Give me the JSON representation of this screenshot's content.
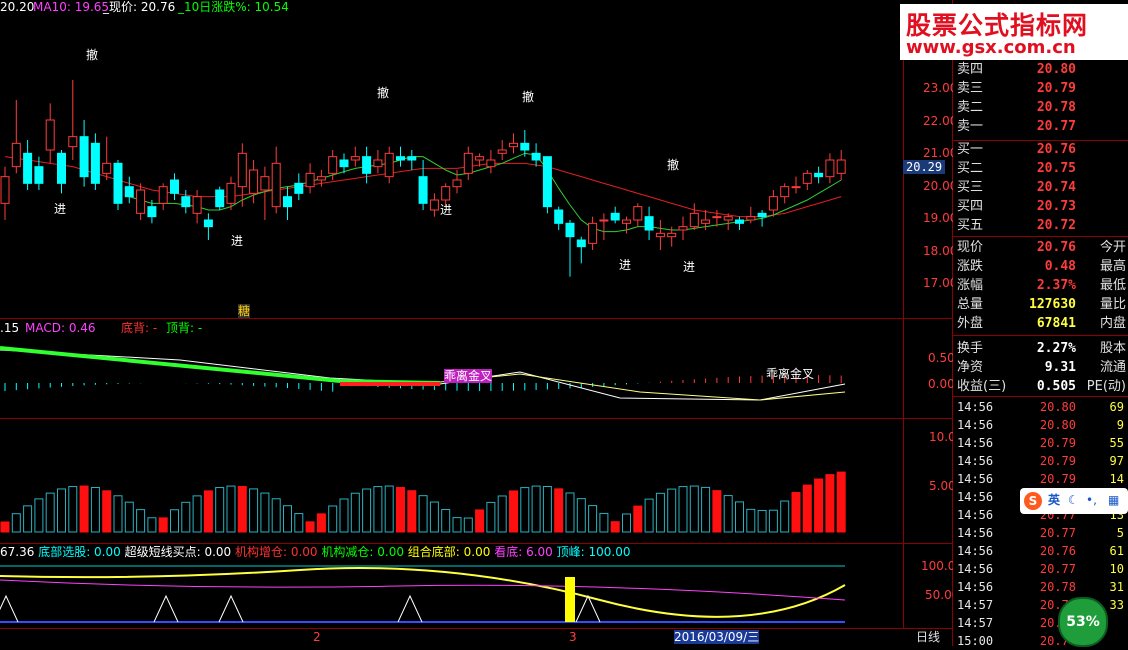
{
  "top_bar": {
    "ma5": "20.20",
    "ma10_label": "MA10: 19.65",
    "current_label": "_现价: 20.76",
    "change10_label": "_10日涨跌%: 10.54"
  },
  "logo": {
    "line1": "股票公式指标网",
    "line2": "www.gsx.com.cn"
  },
  "main_chart": {
    "price_axis": [
      "23.00",
      "22.00",
      "21.00",
      "20.00",
      "19.00",
      "18.00",
      "17.00"
    ],
    "current_price_tag": "20.29",
    "markers": {
      "sell": "撤",
      "buy": "进",
      "bottom": "糖"
    }
  },
  "macd_panel": {
    "header_value": ".15",
    "macd_label": "MACD: 0.46",
    "bottom_div": "底背: -",
    "top_div": "顶背: -",
    "axis": [
      "0.50",
      "0.00"
    ],
    "golden_cross": "乖离金叉",
    "death_cross": "乖离金叉"
  },
  "volume_panel": {
    "axis": [
      "10.00",
      "5.00"
    ]
  },
  "indicator_panel": {
    "value": "67.36",
    "items": [
      {
        "label": "底部选股: 0.00",
        "color": "#00ffff"
      },
      {
        "label": "超级短线买点: 0.00",
        "color": "#ffffff"
      },
      {
        "label": "机构增仓: 0.00",
        "color": "#ff3030"
      },
      {
        "label": "机构减仓: 0.00",
        "color": "#00ff00"
      },
      {
        "label": "组合底部: 0.00",
        "color": "#ffff00"
      },
      {
        "label": "看底: 6.00",
        "color": "#ff40ff"
      },
      {
        "label": "顶峰: 100.00",
        "color": "#00ffff"
      }
    ],
    "axis": [
      "100.0",
      "50.00"
    ]
  },
  "time_axis": {
    "labels": [
      "2",
      "3"
    ],
    "date_label": "2016/03/09/三",
    "period": "日线"
  },
  "order_book": [
    {
      "label": "卖四",
      "price": "20.80"
    },
    {
      "label": "卖三",
      "price": "20.79"
    },
    {
      "label": "卖二",
      "price": "20.78"
    },
    {
      "label": "卖一",
      "price": "20.77"
    },
    {
      "label": "买一",
      "price": "20.76"
    },
    {
      "label": "买二",
      "price": "20.75"
    },
    {
      "label": "买三",
      "price": "20.74"
    },
    {
      "label": "买四",
      "price": "20.73"
    },
    {
      "label": "买五",
      "price": "20.72"
    }
  ],
  "quote": [
    {
      "label": "现价",
      "value": "20.76",
      "label2": "今开"
    },
    {
      "label": "涨跌",
      "value": "0.48",
      "label2": "最高"
    },
    {
      "label": "涨幅",
      "value": "2.37%",
      "label2": "最低"
    },
    {
      "label": "总量",
      "value": "127630",
      "label2": "量比"
    },
    {
      "label": "外盘",
      "value": "67841",
      "label2": "内盘"
    },
    {
      "label": "换手",
      "value": "2.27%",
      "label2": "股本"
    },
    {
      "label": "净资",
      "value": "9.31",
      "label2": "流通"
    },
    {
      "label": "收益(三)",
      "value": "0.505",
      "label2": "PE(动)"
    }
  ],
  "ticks": [
    {
      "time": "14:56",
      "price": "20.80",
      "vol": "69"
    },
    {
      "time": "14:56",
      "price": "20.80",
      "vol": "9"
    },
    {
      "time": "14:56",
      "price": "20.79",
      "vol": "55"
    },
    {
      "time": "14:56",
      "price": "20.79",
      "vol": "97"
    },
    {
      "time": "14:56",
      "price": "20.79",
      "vol": "14"
    },
    {
      "time": "14:56",
      "price": "",
      "vol": "1"
    },
    {
      "time": "14:56",
      "price": "20.77",
      "vol": "13"
    },
    {
      "time": "14:56",
      "price": "20.77",
      "vol": "5"
    },
    {
      "time": "14:56",
      "price": "20.76",
      "vol": "61"
    },
    {
      "time": "14:56",
      "price": "20.77",
      "vol": "10"
    },
    {
      "time": "14:56",
      "price": "20.78",
      "vol": "31"
    },
    {
      "time": "14:57",
      "price": "20.77",
      "vol": "33"
    },
    {
      "time": "14:57",
      "price": "20.77",
      "vol": ""
    },
    {
      "time": "15:00",
      "price": "20.76",
      "vol": ""
    }
  ],
  "badge": "53%",
  "ime": "英",
  "chart_data": {
    "type": "candlestick",
    "ylim": [
      16.6,
      23.8
    ],
    "candles": [
      [
        19.5,
        20.3,
        19.0,
        20.6
      ],
      [
        20.6,
        21.3,
        20.4,
        22.6
      ],
      [
        21.0,
        20.1,
        19.9,
        21.4
      ],
      [
        20.6,
        20.1,
        19.9,
        20.9
      ],
      [
        21.1,
        22.0,
        20.7,
        22.5
      ],
      [
        21.0,
        20.1,
        19.8,
        21.1
      ],
      [
        21.2,
        21.5,
        20.8,
        23.2
      ],
      [
        21.5,
        20.3,
        20.0,
        22.0
      ],
      [
        21.3,
        20.1,
        19.9,
        21.6
      ],
      [
        20.4,
        20.7,
        20.2,
        21.5
      ],
      [
        20.7,
        19.5,
        19.3,
        20.8
      ],
      [
        20.0,
        19.7,
        19.5,
        20.3
      ],
      [
        19.2,
        19.9,
        19.0,
        20.1
      ],
      [
        19.4,
        19.1,
        18.9,
        19.6
      ],
      [
        19.5,
        20.0,
        19.3,
        20.1
      ],
      [
        20.2,
        19.8,
        19.6,
        20.4
      ],
      [
        19.7,
        19.4,
        19.2,
        19.9
      ],
      [
        19.2,
        19.7,
        18.9,
        19.9
      ],
      [
        19.0,
        18.8,
        18.4,
        19.2
      ],
      [
        19.9,
        19.4,
        19.3,
        20.0
      ],
      [
        19.5,
        20.1,
        19.3,
        20.3
      ],
      [
        20.0,
        21.0,
        19.4,
        21.3
      ],
      [
        19.8,
        20.5,
        19.5,
        20.8
      ],
      [
        19.9,
        20.3,
        19.0,
        20.6
      ],
      [
        19.4,
        20.7,
        19.2,
        21.2
      ],
      [
        19.7,
        19.4,
        19.0,
        20.0
      ],
      [
        20.1,
        19.8,
        19.6,
        20.4
      ],
      [
        20.0,
        20.4,
        19.8,
        20.7
      ],
      [
        20.2,
        20.3,
        20.0,
        20.5
      ],
      [
        20.4,
        20.9,
        20.2,
        21.1
      ],
      [
        20.8,
        20.6,
        20.4,
        21.0
      ],
      [
        20.8,
        20.9,
        20.6,
        21.2
      ],
      [
        20.9,
        20.4,
        20.1,
        21.2
      ],
      [
        20.6,
        20.8,
        20.4,
        21.1
      ],
      [
        20.3,
        21.0,
        20.1,
        21.2
      ],
      [
        20.9,
        20.8,
        20.6,
        21.2
      ],
      [
        20.9,
        20.8,
        20.5,
        21.1
      ],
      [
        20.3,
        19.5,
        19.3,
        20.8
      ],
      [
        19.3,
        19.6,
        19.1,
        19.8
      ],
      [
        19.6,
        20.0,
        19.4,
        20.1
      ],
      [
        20.0,
        20.2,
        19.8,
        20.5
      ],
      [
        20.4,
        21.0,
        20.2,
        21.2
      ],
      [
        20.8,
        20.9,
        20.6,
        21.0
      ],
      [
        20.6,
        20.8,
        20.4,
        21.1
      ],
      [
        21.0,
        21.1,
        20.8,
        21.4
      ],
      [
        21.2,
        21.3,
        21.0,
        21.6
      ],
      [
        21.3,
        21.1,
        20.9,
        21.7
      ],
      [
        21.0,
        20.8,
        20.6,
        21.3
      ],
      [
        20.9,
        19.4,
        19.2,
        20.9
      ],
      [
        19.3,
        18.9,
        18.7,
        19.4
      ],
      [
        18.9,
        18.5,
        17.3,
        19.0
      ],
      [
        18.4,
        18.2,
        17.7,
        18.5
      ],
      [
        18.3,
        18.9,
        18.1,
        19.1
      ],
      [
        19.0,
        19.0,
        18.4,
        19.2
      ],
      [
        19.2,
        19.0,
        18.9,
        19.4
      ],
      [
        18.9,
        19.0,
        18.6,
        19.1
      ],
      [
        19.0,
        19.4,
        18.8,
        19.5
      ],
      [
        19.1,
        18.7,
        18.4,
        19.4
      ],
      [
        18.5,
        18.6,
        18.1,
        19.0
      ],
      [
        18.5,
        18.6,
        18.2,
        18.8
      ],
      [
        18.7,
        18.8,
        18.4,
        19.1
      ],
      [
        18.8,
        19.2,
        18.7,
        19.5
      ],
      [
        18.9,
        19.0,
        18.7,
        19.3
      ],
      [
        19.1,
        19.1,
        18.8,
        19.3
      ],
      [
        19.0,
        19.1,
        18.7,
        19.2
      ],
      [
        19.0,
        18.9,
        18.7,
        19.1
      ],
      [
        19.0,
        19.1,
        18.9,
        19.4
      ],
      [
        19.2,
        19.1,
        18.8,
        19.3
      ],
      [
        19.3,
        19.7,
        19.1,
        19.9
      ],
      [
        19.7,
        20.0,
        19.5,
        20.1
      ],
      [
        20.0,
        20.0,
        19.8,
        20.3
      ],
      [
        20.1,
        20.4,
        19.9,
        20.5
      ],
      [
        20.4,
        20.3,
        20.1,
        20.6
      ],
      [
        20.3,
        20.8,
        20.1,
        21.0
      ],
      [
        20.4,
        20.8,
        20.2,
        21.1
      ]
    ],
    "ma_red": [
      20.9,
      20.85,
      20.8,
      20.75,
      20.7,
      20.65,
      20.6,
      20.5,
      20.4,
      20.3,
      20.2,
      20.1,
      20.0,
      19.9,
      19.85,
      19.8,
      19.75,
      19.7,
      19.7,
      19.7,
      19.7,
      19.75,
      19.8,
      19.85,
      19.9,
      19.95,
      20.0,
      20.05,
      20.1,
      20.15,
      20.2,
      20.25,
      20.3,
      20.35,
      20.4,
      20.45,
      20.5,
      20.55,
      20.55,
      20.55,
      20.55,
      20.6,
      20.65,
      20.7,
      20.7,
      20.7,
      20.7,
      20.65,
      20.6,
      20.5,
      20.4,
      20.3,
      20.2,
      20.1,
      20.0,
      19.9,
      19.8,
      19.7,
      19.6,
      19.5,
      19.4,
      19.3,
      19.25,
      19.2,
      19.15,
      19.1,
      19.1,
      19.1,
      19.15,
      19.2,
      19.3,
      19.4,
      19.5,
      19.6,
      19.7
    ],
    "ma_green": [
      null,
      null,
      null,
      null,
      null,
      null,
      null,
      null,
      null,
      null,
      null,
      19.7,
      19.6,
      19.5,
      19.5,
      19.5,
      19.45,
      19.4,
      19.3,
      19.3,
      19.4,
      19.6,
      19.75,
      19.85,
      19.95,
      20.0,
      20.05,
      20.15,
      20.25,
      20.35,
      20.45,
      20.55,
      20.6,
      20.65,
      20.7,
      20.8,
      20.9,
      20.9,
      20.7,
      20.5,
      20.35,
      20.4,
      20.5,
      20.6,
      20.7,
      20.85,
      21.0,
      20.95,
      20.5,
      19.95,
      19.45,
      19.0,
      18.75,
      18.65,
      18.65,
      18.7,
      18.8,
      18.8,
      18.75,
      18.7,
      18.7,
      18.75,
      18.8,
      18.85,
      18.9,
      18.95,
      19.0,
      19.05,
      19.15,
      19.3,
      19.45,
      19.6,
      19.8,
      20.0,
      20.2
    ]
  }
}
